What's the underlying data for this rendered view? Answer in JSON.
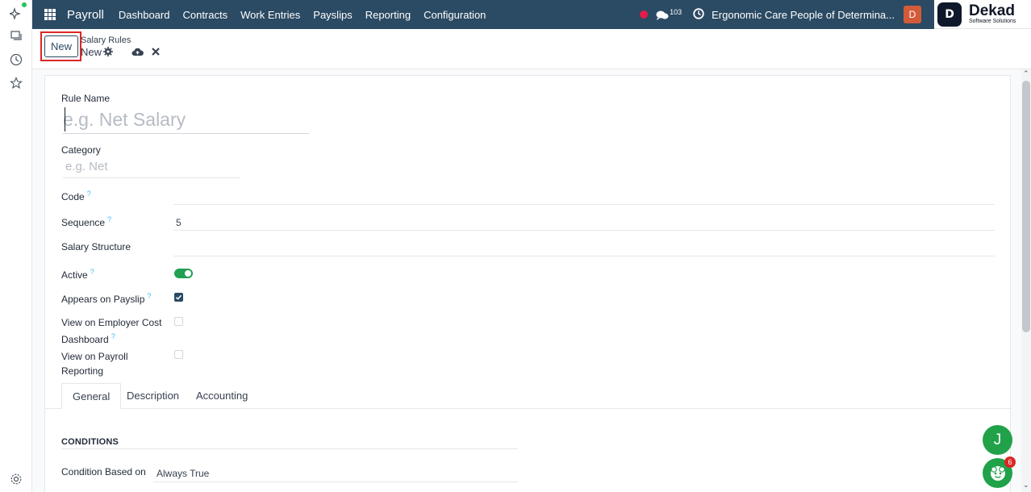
{
  "topbar": {
    "app_name": "Payroll",
    "menu": [
      "Dashboard",
      "Contracts",
      "Work Entries",
      "Payslips",
      "Reporting",
      "Configuration"
    ],
    "message_count": "103",
    "company": "Ergonomic Care People of Determina...",
    "user_initial": "D"
  },
  "brand": {
    "name": "Dekad",
    "subtitle": "Software Solutions",
    "mark": "D"
  },
  "control_panel": {
    "new_label": "New",
    "breadcrumb_parent": "Salary Rules",
    "breadcrumb_current": "New"
  },
  "form": {
    "rule_name_label": "Rule Name",
    "rule_name_placeholder": "e.g. Net Salary",
    "category_label": "Category",
    "category_placeholder": "e.g. Net",
    "code_label": "Code",
    "sequence_label": "Sequence",
    "sequence_value": "5",
    "salary_structure_label": "Salary Structure",
    "active_label": "Active",
    "appears_on_payslip_label": "Appears on Payslip",
    "employer_cost_label_1": "View on Employer Cost",
    "employer_cost_label_2": "Dashboard",
    "payroll_reporting_label_1": "View on Payroll",
    "payroll_reporting_label_2": "Reporting",
    "help_mark": "?"
  },
  "tabs": [
    "General",
    "Description",
    "Accounting"
  ],
  "conditions": {
    "title": "CONDITIONS",
    "condition_label": "Condition Based on",
    "condition_value": "Always True"
  },
  "floating": {
    "assistant_initial": "J",
    "bot_badge": "6"
  },
  "colors": {
    "topbar": "#2b4a63",
    "accent_green": "#21a24a",
    "highlight_red": "#dc2626"
  }
}
